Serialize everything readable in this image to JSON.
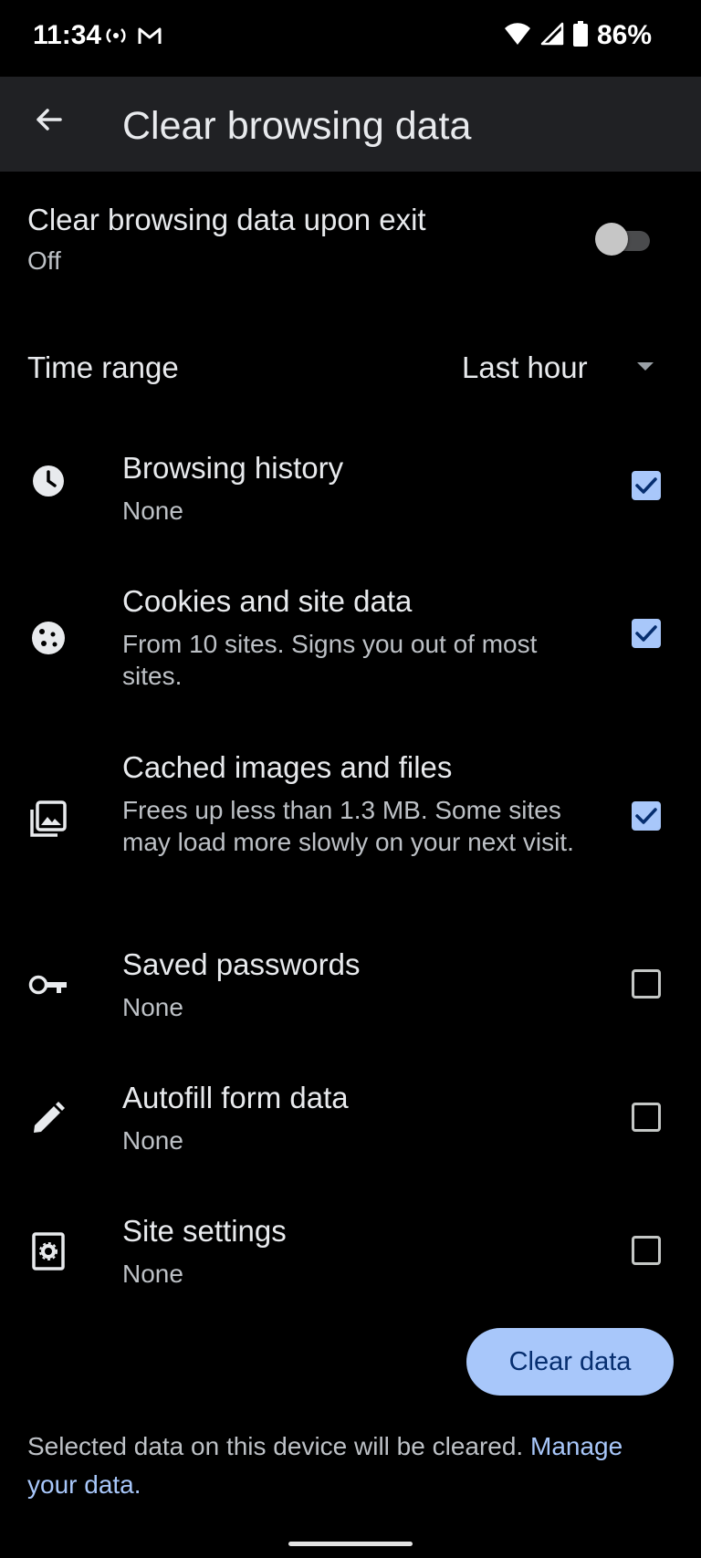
{
  "status_bar": {
    "time": "11:34",
    "battery_percent": "86%",
    "icons": [
      "hotspot-icon",
      "gmail-icon",
      "wifi-icon",
      "signal-icon",
      "battery-icon"
    ]
  },
  "app_bar": {
    "title": "Clear browsing data",
    "back_icon": "arrow-back-icon"
  },
  "clear_on_exit": {
    "label": "Clear browsing data upon exit",
    "value": "Off",
    "enabled": false
  },
  "time_range": {
    "label": "Time range",
    "selected": "Last hour"
  },
  "items": [
    {
      "icon": "clock-icon",
      "title": "Browsing history",
      "subtitle": "None",
      "checked": true
    },
    {
      "icon": "cookie-icon",
      "title": "Cookies and site data",
      "subtitle": "From 10 sites. Signs you out of most sites.",
      "checked": true
    },
    {
      "icon": "image-icon",
      "title": "Cached images and files",
      "subtitle": "Frees up less than 1.3 MB. Some sites may load more slowly on your next visit.",
      "checked": true
    },
    {
      "icon": "key-icon",
      "title": "Saved passwords",
      "subtitle": "None",
      "checked": false
    },
    {
      "icon": "pencil-icon",
      "title": "Autofill form data",
      "subtitle": "None",
      "checked": false
    },
    {
      "icon": "site-settings-icon",
      "title": "Site settings",
      "subtitle": "None",
      "checked": false
    }
  ],
  "actions": {
    "clear_data_label": "Clear data"
  },
  "footer": {
    "text": "Selected data on this device will be cleared.",
    "link": "Manage your data."
  },
  "colors": {
    "accent": "#a8c7fa",
    "background": "#000000",
    "app_bar": "#202124"
  }
}
